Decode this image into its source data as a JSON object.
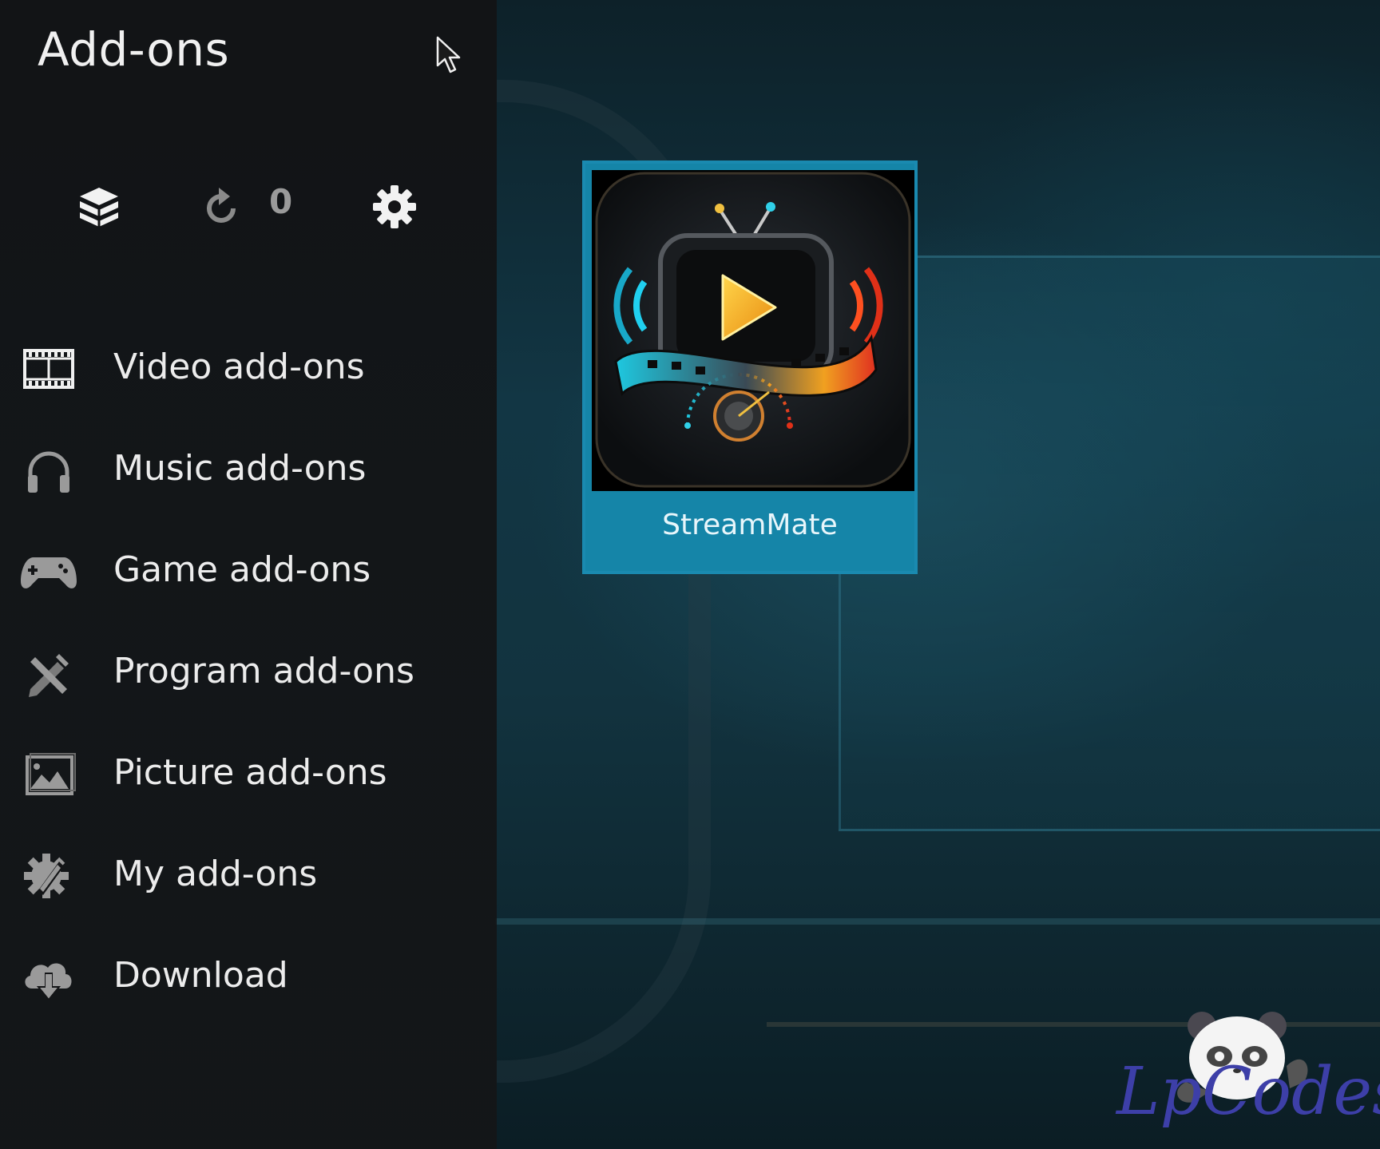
{
  "window": {
    "title": "Add-ons"
  },
  "toolbar": {
    "install_icon": "box-install-icon",
    "updates_icon": "refresh-icon",
    "updates_count": "0",
    "settings_icon": "gear-icon"
  },
  "menu": {
    "items": [
      {
        "label": "Video add-ons",
        "icon": "film-icon"
      },
      {
        "label": "Music add-ons",
        "icon": "headphones-icon"
      },
      {
        "label": "Game add-ons",
        "icon": "gamepad-icon"
      },
      {
        "label": "Program add-ons",
        "icon": "tools-icon"
      },
      {
        "label": "Picture add-ons",
        "icon": "picture-icon"
      },
      {
        "label": "My add-ons",
        "icon": "gear-wrench-icon"
      },
      {
        "label": "Download",
        "icon": "cloud-download-icon"
      }
    ]
  },
  "addons": [
    {
      "name": "StreamMate",
      "icon": "tv-play-logo"
    }
  ],
  "watermark": {
    "text": "LpCodes"
  },
  "colors": {
    "tile_accent": "#1585a8",
    "sidebar_bg": "#131416",
    "text": "#ececec"
  }
}
